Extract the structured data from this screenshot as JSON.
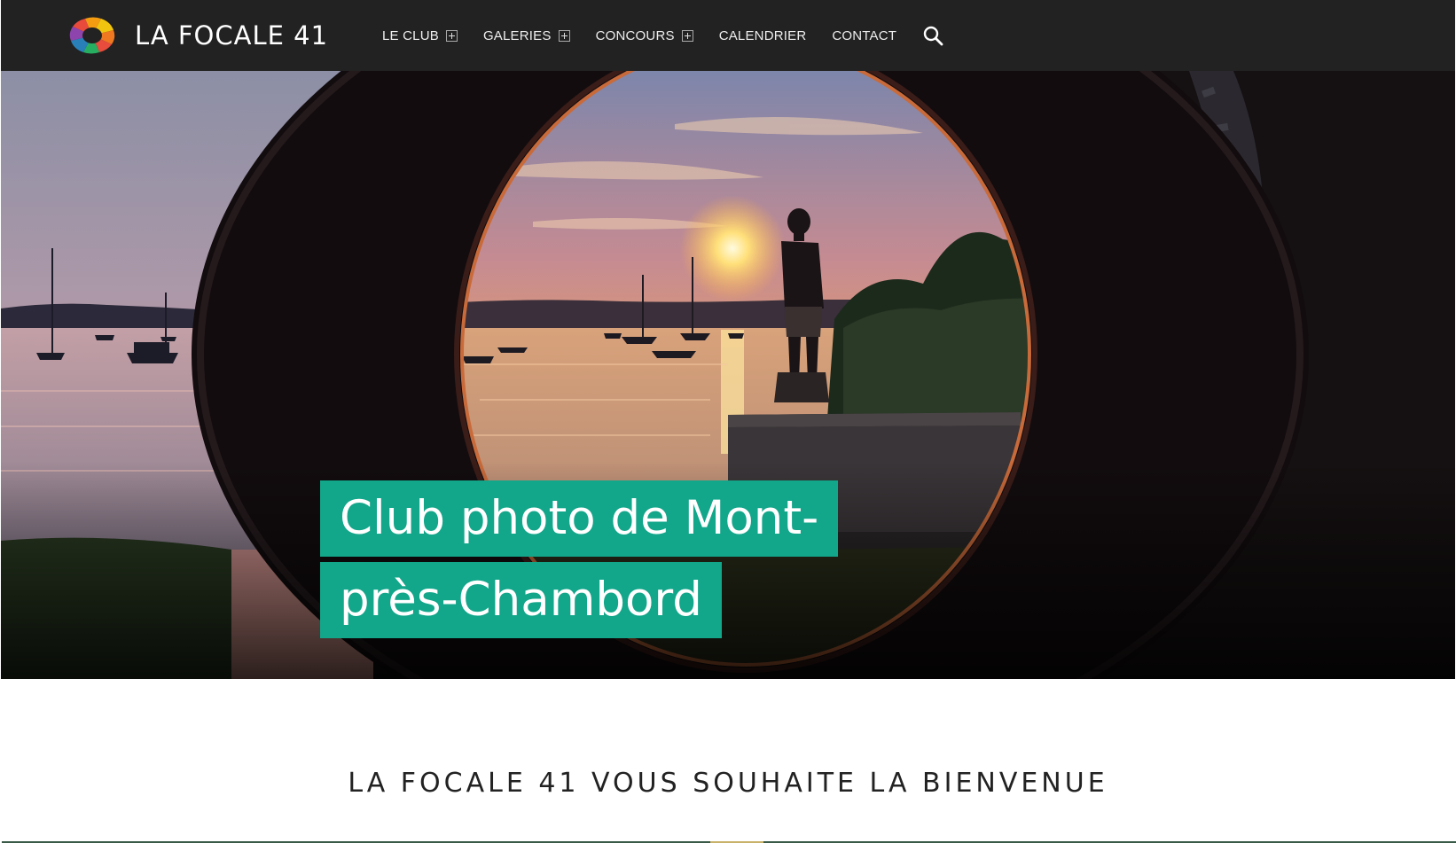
{
  "brand": {
    "name": "LA FOCALE 41",
    "logo_icon": "camera-aperture-icon"
  },
  "nav": {
    "items": [
      {
        "label": "LE CLUB",
        "has_submenu": true
      },
      {
        "label": "GALERIES",
        "has_submenu": true
      },
      {
        "label": "CONCOURS",
        "has_submenu": true
      },
      {
        "label": "CALENDRIER",
        "has_submenu": false
      },
      {
        "label": "CONTACT",
        "has_submenu": false
      }
    ],
    "search_icon": "search-icon"
  },
  "hero": {
    "title_line1": "Club photo de Mont-",
    "title_line2": "près-Chambord",
    "image": "sunset-lake-through-tire-photo"
  },
  "welcome": {
    "heading": "LA FOCALE 41 VOUS SOUHAITE LA BIENVENUE"
  },
  "colors": {
    "header_bg": "#222222",
    "accent": "#12a68a",
    "text_dark": "#222222"
  }
}
